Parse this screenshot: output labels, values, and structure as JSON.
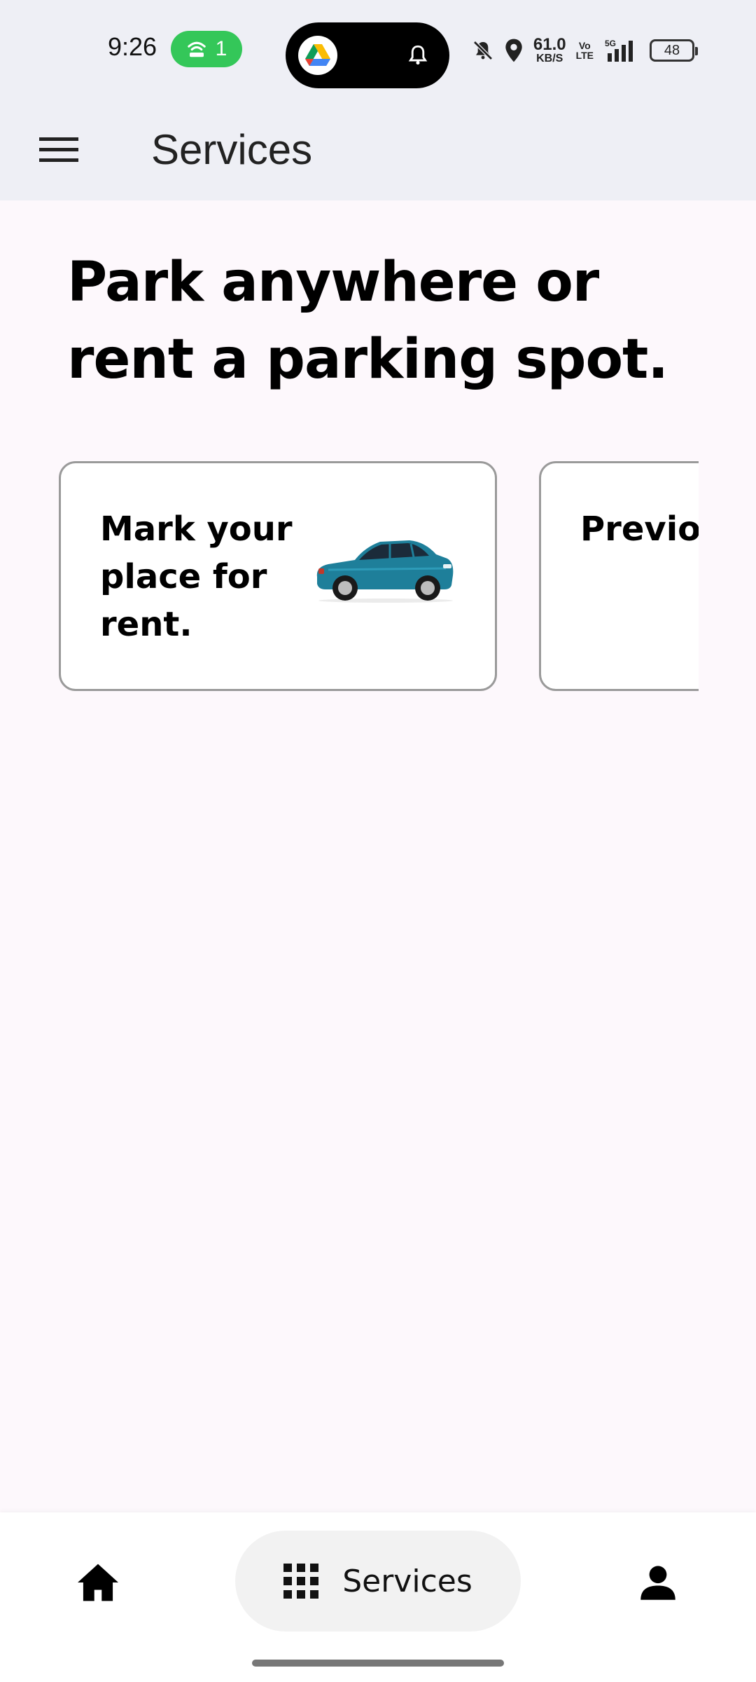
{
  "status_bar": {
    "time": "9:26",
    "hotspot_count": "1",
    "net_speed_value": "61.0",
    "net_speed_unit": "KB/S",
    "volte_top": "Vo",
    "volte_bottom": "LTE",
    "network": "5G",
    "battery": "48"
  },
  "app_bar": {
    "title": "Services",
    "menu_icon": "hamburger-menu-icon"
  },
  "headline": "Park anywhere or rent a parking spot.",
  "cards": [
    {
      "label": "Mark your place for rent.",
      "icon": "car-icon"
    },
    {
      "label": "Previous parking spots."
    }
  ],
  "bottom_nav": {
    "home_icon": "home-icon",
    "services_label": "Services",
    "services_icon": "grid-icon",
    "profile_icon": "person-icon"
  },
  "colors": {
    "status_bar_bg": "#eeeff5",
    "page_bg": "#fdf8fc",
    "hotspot_green": "#34c759",
    "car_teal": "#1e7f9a"
  }
}
